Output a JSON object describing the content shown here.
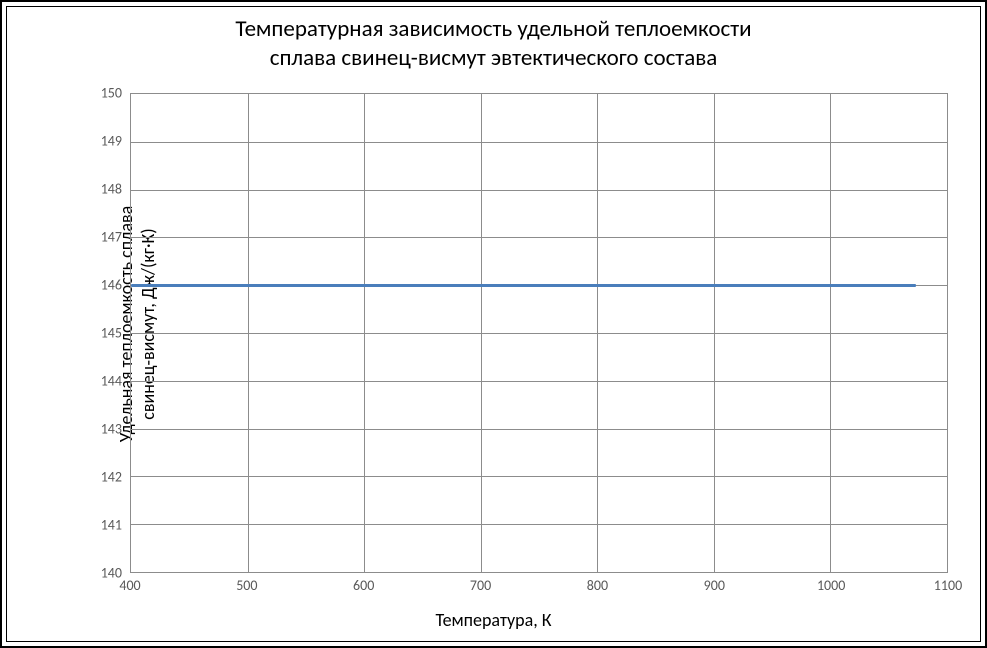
{
  "title_line1": "Температурная зависимость удельной теплоемкости",
  "title_line2": "сплава свинец-висмут эвтектического состава",
  "xlabel": "Температура, К",
  "ylabel": "Удельная теплоемкость сплава\nсвинец-висмут, Дж/(кг·К)",
  "chart_data": {
    "type": "line",
    "xlim": [
      400,
      1100
    ],
    "ylim": [
      140,
      150
    ],
    "xticks": [
      400,
      500,
      600,
      700,
      800,
      900,
      1000,
      1100
    ],
    "yticks": [
      140,
      141,
      142,
      143,
      144,
      145,
      146,
      147,
      148,
      149,
      150
    ],
    "series": [
      {
        "name": "Удельная теплоемкость",
        "color": "#4A7EBB",
        "x": [
          400,
          1073
        ],
        "y": [
          146,
          146
        ]
      }
    ]
  }
}
